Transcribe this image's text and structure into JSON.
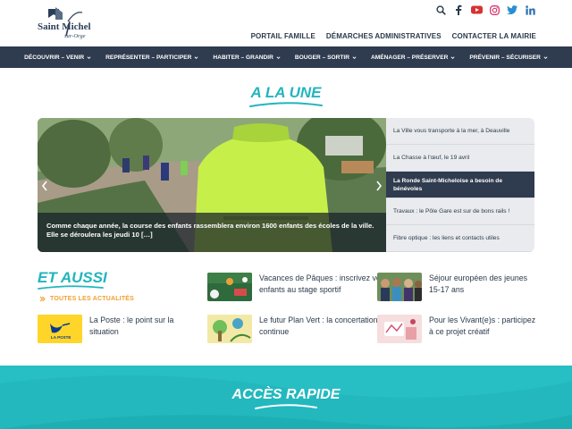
{
  "site": {
    "logo_main": "Saint Michel",
    "logo_sub": "sur-Orge"
  },
  "social": [
    "search-icon",
    "facebook-icon",
    "youtube-icon",
    "instagram-icon",
    "twitter-icon",
    "linkedin-icon"
  ],
  "topnav": [
    "PORTAIL FAMILLE",
    "DÉMARCHES ADMINISTRATIVES",
    "CONTACTER LA MAIRIE"
  ],
  "mainnav": [
    "DÉCOUVRIR – VENIR",
    "REPRÉSENTER – PARTICIPER",
    "HABITER – GRANDIR",
    "BOUGER – SORTIR",
    "AMÉNAGER – PRÉSERVER",
    "PRÉVENIR – SÉCURISER"
  ],
  "alaune": {
    "title": "A LA UNE",
    "slide_caption": "Comme chaque année, la course des enfants rassemblera environ 1600 enfants des écoles de la ville. Elle se déroulera les jeudi 10 […]",
    "side_items": [
      "La Ville vous transporte à la mer, à Deauville",
      "La Chasse à l'œuf, le 19 avril",
      "La Ronde Saint-Micheloise a besoin de bénévoles",
      "Travaux : le Pôle Gare est sur de bons rails !",
      "Fibre optique : les liens et contacts utiles"
    ],
    "active_index": 2
  },
  "etaussi": {
    "title": "ET AUSSI",
    "all_news": "TOUTES LES ACTUALITÉS",
    "cards": [
      "Vacances de Pâques : inscrivez vos enfants au stage sportif",
      "Séjour européen des jeunes 15-17 ans",
      "La Poste : le point sur la situation",
      "Le futur Plan Vert : la concertation continue",
      "Pour les Vivant(e)s : participez à ce projet créatif"
    ],
    "laposte_logo_text": "LA POSTE"
  },
  "acces": {
    "title": "ACCÈS RAPIDE"
  },
  "colors": {
    "navy": "#2f3b4e",
    "turquoise": "#22b5bd",
    "orange": "#f0a030"
  }
}
